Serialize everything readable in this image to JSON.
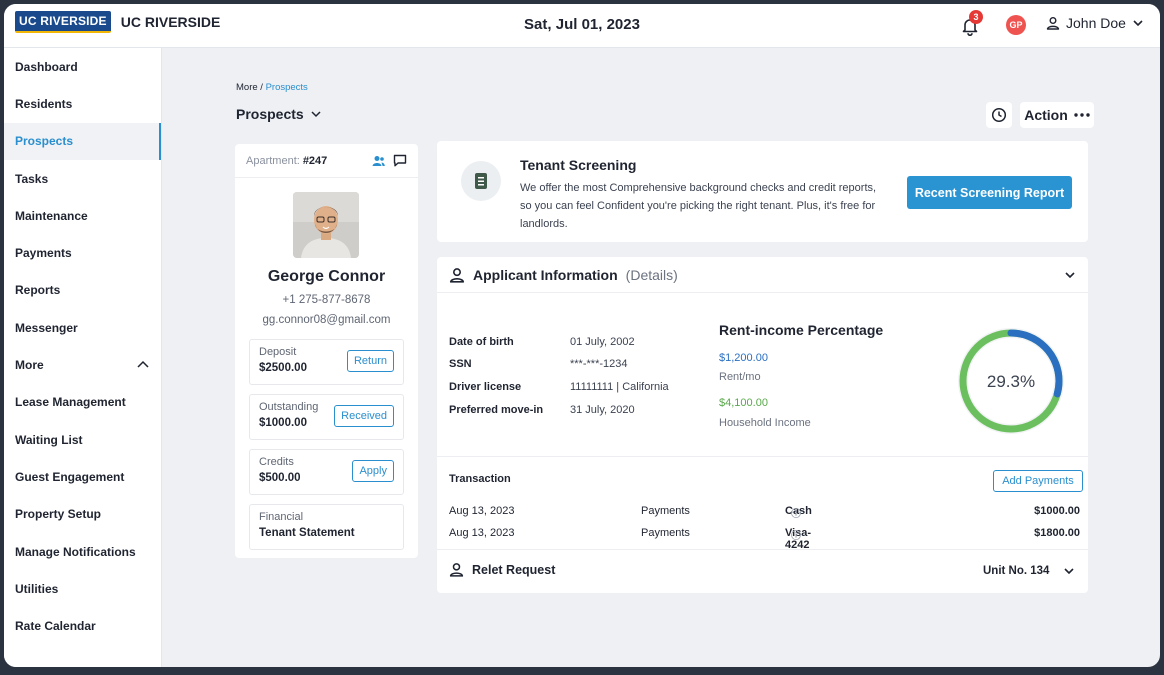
{
  "header": {
    "logo_mark": "UC RIVERSIDE",
    "logo_text": "UC RIVERSIDE",
    "date": "Sat, Jul 01, 2023",
    "notification_count": "3",
    "avatar_initials": "GP",
    "user_name": "John Doe"
  },
  "sidebar": {
    "items": [
      {
        "label": "Dashboard"
      },
      {
        "label": "Residents"
      },
      {
        "label": "Prospects"
      },
      {
        "label": "Tasks"
      },
      {
        "label": "Maintenance"
      },
      {
        "label": "Payments"
      },
      {
        "label": "Reports"
      },
      {
        "label": "Messenger"
      },
      {
        "label": "More"
      },
      {
        "label": "Lease Management"
      },
      {
        "label": "Waiting List"
      },
      {
        "label": "Guest Engagement"
      },
      {
        "label": "Property Setup"
      },
      {
        "label": "Manage Notifications"
      },
      {
        "label": "Utilities"
      },
      {
        "label": "Rate Calendar"
      }
    ],
    "active": "Prospects"
  },
  "breadcrumb": {
    "parent": "More / ",
    "current": "Prospects"
  },
  "page": {
    "title": "Prospects",
    "action_label": "Action"
  },
  "profile": {
    "apartment_label": "Apartment:",
    "apartment_no": "#247",
    "name": "George Connor",
    "phone": "+1 275-877-8678",
    "email": "gg.connor08@gmail.com",
    "deposit": {
      "label": "Deposit",
      "value": "$2500.00",
      "button": "Return"
    },
    "outstanding": {
      "label": "Outstanding",
      "value": "$1000.00",
      "button": "Received"
    },
    "credits": {
      "label": "Credits",
      "value": "$500.00",
      "button": "Apply"
    },
    "financial": {
      "label": "Financial",
      "value": "Tenant Statement"
    }
  },
  "screening": {
    "title": "Tenant Screening",
    "description": "We offer the most Comprehensive background checks and credit reports, so you can feel Confident you're picking the right tenant. Plus, it's free for landlords.",
    "button": "Recent Screening Report"
  },
  "applicant": {
    "title": "Applicant Information",
    "details": "(Details)",
    "fields": [
      {
        "key": "Date of birth",
        "value": "01 July, 2002"
      },
      {
        "key": "SSN",
        "value": "***-***-1234"
      },
      {
        "key": "Driver license",
        "value": "11111111 | California"
      },
      {
        "key": "Preferred move-in",
        "value": "31 July, 2020"
      }
    ],
    "rent_income": {
      "title": "Rent-income Percentage",
      "rent_amount": "$1,200.00",
      "rent_label": "Rent/mo",
      "income_amount": "$4,100.00",
      "income_label": "Household Income",
      "percentage_text": "29.3%",
      "percentage": 29.3,
      "rent_color": "#2a6fc0",
      "income_color": "#6cbf5e"
    }
  },
  "transactions": {
    "title": "Transaction",
    "add_button": "Add Payments",
    "rows": [
      {
        "date": "Aug 13, 2023",
        "type": "Payments",
        "method": "Cash",
        "amount": "$1000.00"
      },
      {
        "date": "Aug 13, 2023",
        "type": "Payments",
        "method": "Visa-4242",
        "amount": "$1800.00"
      }
    ]
  },
  "relet": {
    "title": "Relet Request",
    "unit": "Unit No. 134"
  },
  "colors": {
    "accent": "#2a8fce",
    "primary_button": "#2a94d3",
    "badge_red": "#e53935"
  }
}
